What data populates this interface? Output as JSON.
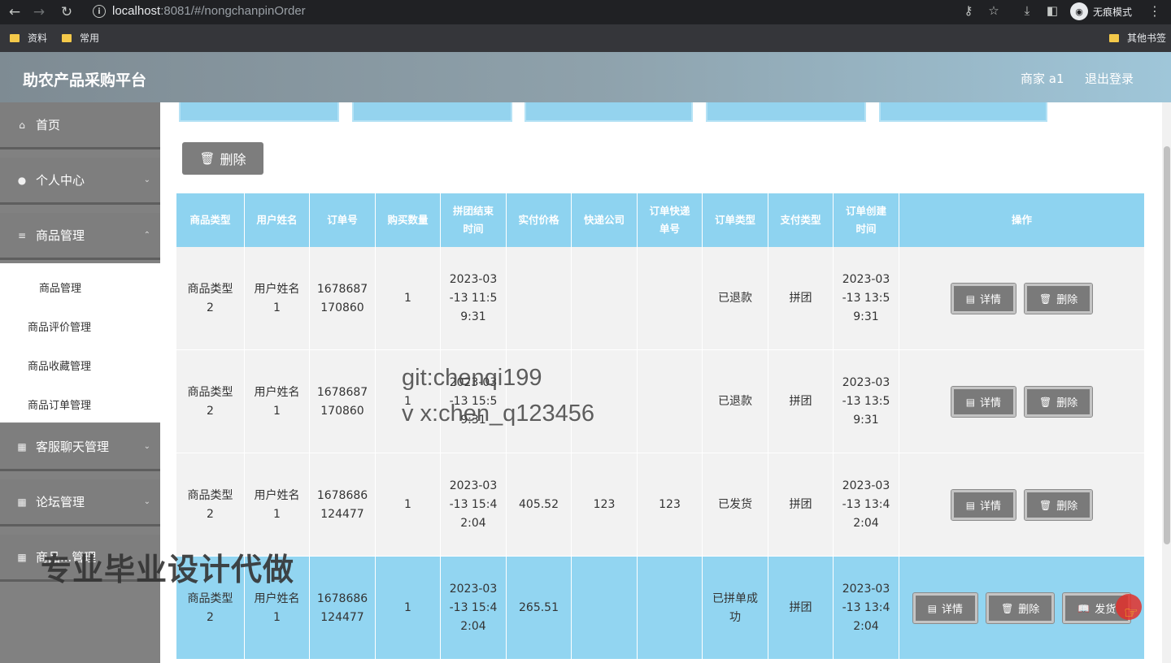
{
  "browser": {
    "url_host": "localhost",
    "url_rest": ":8081/#/nongchanpinOrder",
    "incognito_label": "无痕模式",
    "bookmarks": [
      "资料",
      "常用"
    ],
    "other_bookmarks": "其他书签"
  },
  "header": {
    "title": "助农产品采购平台",
    "user": "商家 a1",
    "logout": "退出登录"
  },
  "sidebar": {
    "items": [
      {
        "label": "首页",
        "icon": "home-icon"
      },
      {
        "label": "个人中心",
        "icon": "user-icon"
      },
      {
        "label": "商品管理",
        "icon": "list-icon"
      },
      {
        "label": "客服聊天管理",
        "icon": "grid-icon"
      },
      {
        "label": "论坛管理",
        "icon": "grid-icon"
      },
      {
        "label": "商品...管理",
        "icon": "grid-icon"
      }
    ],
    "sub_items": [
      "商品管理",
      "商品评价管理",
      "商品收藏管理",
      "商品订单管理"
    ]
  },
  "toolbar": {
    "delete_label": "删除"
  },
  "table": {
    "headers": [
      "商品类型",
      "用户姓名",
      "订单号",
      "购买数量",
      "拼团结束\n时间",
      "实付价格",
      "快递公司",
      "订单快递\n单号",
      "订单类型",
      "支付类型",
      "订单创建\n时间",
      "操作"
    ],
    "rows": [
      {
        "type": "商品类型\n2",
        "user": "用户姓名\n1",
        "order_no": "1678687\n170860",
        "qty": "1",
        "end_time": "2023-03\n-13 11:5\n9:31",
        "price": "",
        "express": "",
        "express_no": "",
        "status": "已退款",
        "pay": "拼团",
        "created": "2023-03\n-13 13:5\n9:31",
        "ops": [
          "详情",
          "删除"
        ]
      },
      {
        "type": "商品类型\n2",
        "user": "用户姓名\n1",
        "order_no": "1678687\n170860",
        "qty": "1",
        "end_time": "2023-03\n-13 15:5\n9:31",
        "price": "",
        "express": "",
        "express_no": "",
        "status": "已退款",
        "pay": "拼团",
        "created": "2023-03\n-13 13:5\n9:31",
        "ops": [
          "详情",
          "删除"
        ]
      },
      {
        "type": "商品类型\n2",
        "user": "用户姓名\n1",
        "order_no": "1678686\n124477",
        "qty": "1",
        "end_time": "2023-03\n-13 15:4\n2:04",
        "price": "405.52",
        "express": "123",
        "express_no": "123",
        "status": "已发货",
        "pay": "拼团",
        "created": "2023-03\n-13 13:4\n2:04",
        "ops": [
          "详情",
          "删除"
        ]
      },
      {
        "type": "商品类型\n2",
        "user": "用户姓名\n1",
        "order_no": "1678686\n124477",
        "qty": "1",
        "end_time": "2023-03\n-13 15:4\n2:04",
        "price": "265.51",
        "express": "",
        "express_no": "",
        "status": "已拼单成\n功",
        "pay": "拼团",
        "created": "2023-03\n-13 13:4\n2:04",
        "ops": [
          "详情",
          "删除",
          "发货"
        ]
      }
    ]
  },
  "overlays": {
    "git": "git:chenqi199",
    "vx": "v x:chen_q123456",
    "ad": "专业毕业设计代做"
  },
  "colors": {
    "header_blue": "#8ed3f0",
    "sidebar_gray": "#7e7e7e",
    "button_gray": "#7a7a7a"
  }
}
